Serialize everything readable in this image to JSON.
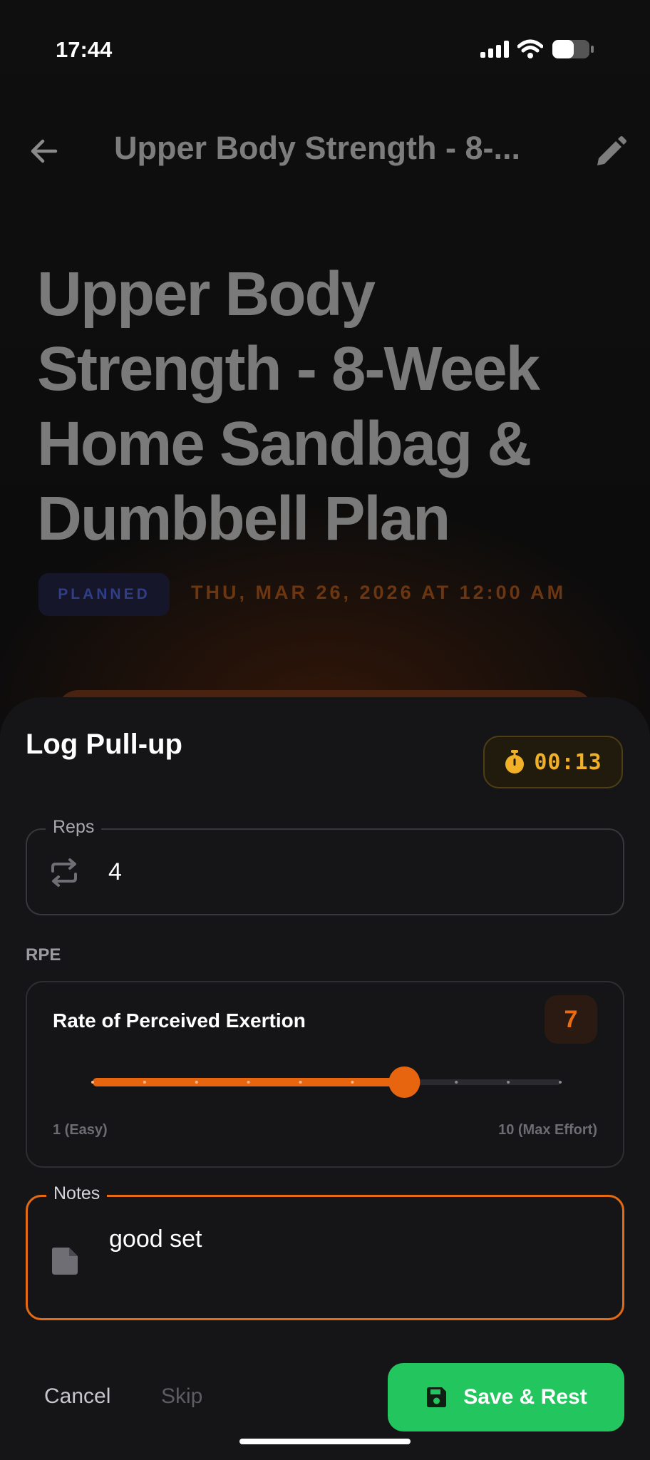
{
  "status_bar": {
    "time": "17:44"
  },
  "page": {
    "header_title": "Upper Body Strength - 8-...",
    "title_lines": [
      "Upper Body",
      "Strength - 8-Week",
      "Home Sandbag &",
      "Dumbbell Plan"
    ],
    "status_chip": "PLANNED",
    "date": "THU, MAR 26, 2026 AT 12:00 AM"
  },
  "sheet": {
    "title": "Log Pull-up",
    "timer": "00:13",
    "reps": {
      "label": "Reps",
      "value": "4"
    },
    "rpe": {
      "section_label": "RPE",
      "card_title": "Rate of Perceived Exertion",
      "value": 7,
      "value_label": "7",
      "min": 1,
      "max": 10,
      "min_label": "1 (Easy)",
      "max_label": "10 (Max Effort)"
    },
    "notes": {
      "label": "Notes",
      "value": "good set"
    },
    "actions": {
      "cancel": "Cancel",
      "skip": "Skip",
      "save": "Save & Rest"
    }
  },
  "colors": {
    "accent": "#E46A14",
    "timer": "#F0B028",
    "save": "#22C55E",
    "chip_text": "#2F3E86"
  }
}
